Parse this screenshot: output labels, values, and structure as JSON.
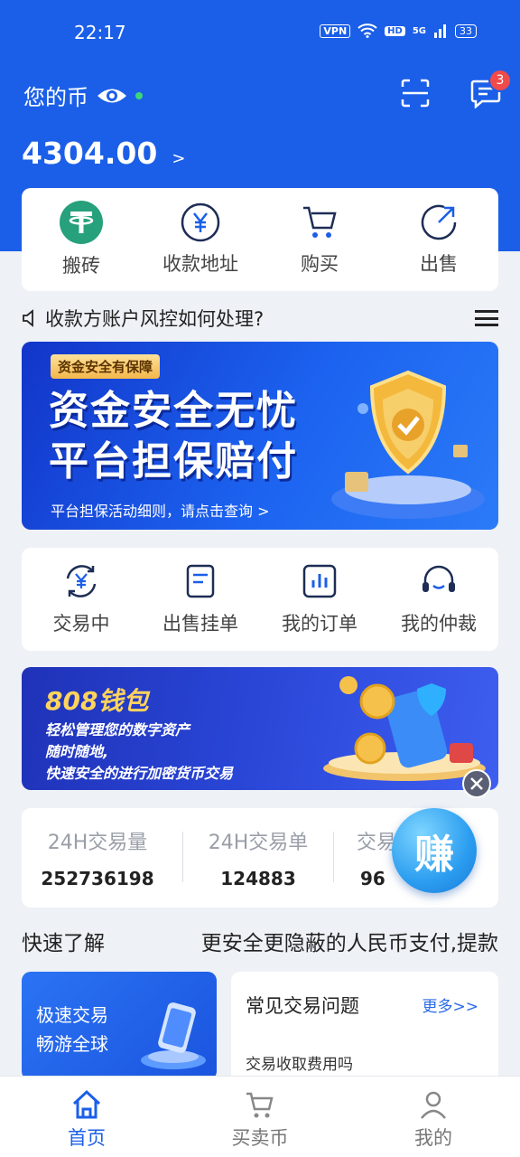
{
  "status": {
    "time": "22:17",
    "vpn": "VPN",
    "hd": "HD",
    "network": "5G",
    "battery": "33"
  },
  "header": {
    "title": "您的币",
    "balance": "4304.00",
    "balance_arrow": ">",
    "badge_count": "3"
  },
  "quick_actions": [
    {
      "label": "搬砖",
      "icon": "tether-icon"
    },
    {
      "label": "收款地址",
      "icon": "yen-circle-icon"
    },
    {
      "label": "购买",
      "icon": "cart-icon"
    },
    {
      "label": "出售",
      "icon": "sell-arrow-icon"
    }
  ],
  "notice": {
    "text": "收款方账户风控如何处理?"
  },
  "banner1": {
    "tag": "资金安全有保障",
    "line1": "资金安全无忧",
    "line2": "平台担保赔付",
    "sub": "平台担保活动细则，请点击查询 >"
  },
  "functions": [
    {
      "label": "交易中",
      "icon": "exchange-yen-icon"
    },
    {
      "label": "出售挂单",
      "icon": "document-icon"
    },
    {
      "label": "我的订单",
      "icon": "chart-bar-icon"
    },
    {
      "label": "我的仲裁",
      "icon": "headset-icon"
    }
  ],
  "banner2": {
    "title": "808钱包",
    "line1": "轻松管理您的数字资产",
    "line2": "随时随地,",
    "line3": "快速安全的进行加密货币交易"
  },
  "stats": [
    {
      "label": "24H交易量",
      "value": "252736198"
    },
    {
      "label": "24H交易单",
      "value": "124883"
    },
    {
      "label": "交易",
      "value": "96"
    }
  ],
  "earn_button": "赚",
  "quick_learn": {
    "title": "快速了解",
    "marquee": "更安全更隐蔽的人民币支付,提款"
  },
  "promo": {
    "line1": "极速交易",
    "line2": "畅游全球"
  },
  "faq": {
    "title": "常见交易问题",
    "more": "更多>>",
    "question": "交易收取费用吗"
  },
  "tabs": [
    {
      "label": "首页",
      "icon": "home-icon",
      "active": true
    },
    {
      "label": "买卖币",
      "icon": "cart-icon",
      "active": false
    },
    {
      "label": "我的",
      "icon": "user-icon",
      "active": false
    }
  ],
  "colors": {
    "primary": "#1b5fe8",
    "tether": "#26a17b",
    "badge": "#f04a4a"
  }
}
